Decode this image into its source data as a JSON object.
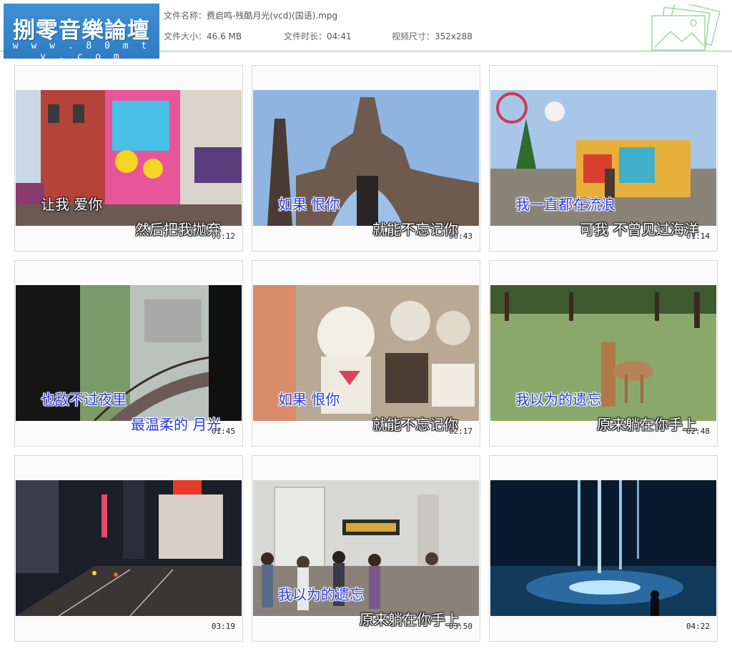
{
  "logo": {
    "title": "捌零音樂論壇",
    "url": "w w w . 8 0 m t v . c o m"
  },
  "file": {
    "name_label": "文件名称：",
    "name": "费启鸣-残酷月光(vcd)(国语).mpg",
    "size_label": "文件大小：",
    "size": "46.6 MB",
    "duration_label": "文件时长：",
    "duration": "04:41",
    "dims_label": "视频尺寸：",
    "dims": "352x288"
  },
  "thumbnails": [
    {
      "timestamp": "00:12",
      "line1": "让我 爱你",
      "line2": "然后把我抛弃"
    },
    {
      "timestamp": "00:43",
      "line1": "如果 恨你",
      "line2": "就能不忘记你"
    },
    {
      "timestamp": "01:14",
      "line1": "我一直都在流浪",
      "line2": "可我 不曾见过海洋"
    },
    {
      "timestamp": "01:45",
      "line1": "也敌不过夜里",
      "line2": "最温柔的 月光"
    },
    {
      "timestamp": "02:17",
      "line1": "如果 恨你",
      "line2": "就能不忘记你"
    },
    {
      "timestamp": "02:48",
      "line1": "我以为的遗忘",
      "line2": "原来躺在你手上"
    },
    {
      "timestamp": "03:19",
      "line1": "",
      "line2": ""
    },
    {
      "timestamp": "03:50",
      "line1": "我以为的遗忘",
      "line2": "原来躺在你手上"
    },
    {
      "timestamp": "04:22",
      "line1": "",
      "line2": ""
    }
  ]
}
